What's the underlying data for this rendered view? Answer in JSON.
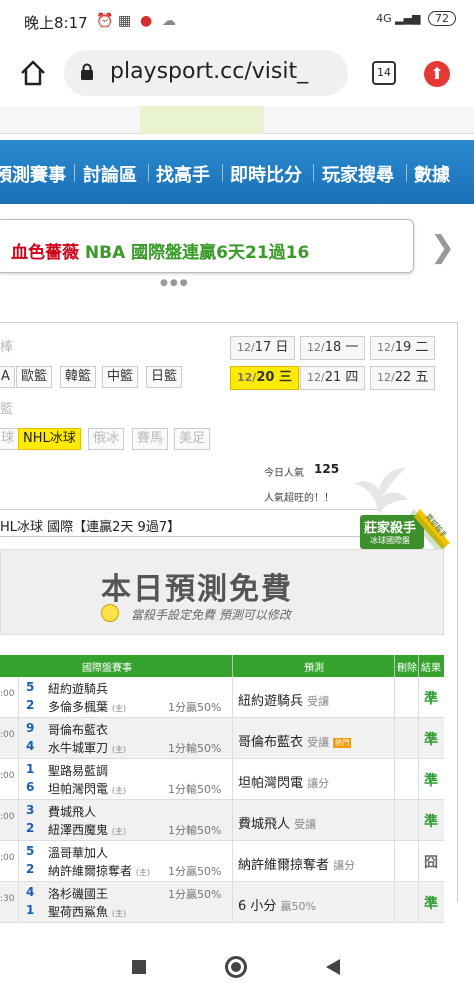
{
  "status_bar": {
    "time": "晚上8:17",
    "network": "4G",
    "battery": "72"
  },
  "browser": {
    "url": "playsport.cc/visit_",
    "tab_count": "14"
  },
  "nav": {
    "items": [
      "預測賽事",
      "討論區",
      "找高手",
      "即時比分",
      "玩家搜尋",
      "數據"
    ]
  },
  "banner": {
    "name": "血色薔薇",
    "text": "NBA 國際盤連贏6天21過16",
    "name_color": "#d0021b",
    "text_color": "#3a9a2a"
  },
  "leagues": {
    "row1": [
      "A",
      "歐籃",
      "韓籃",
      "中籃",
      "日籃"
    ],
    "row3": [
      "球",
      "NHL冰球",
      "俄冰",
      "賽馬",
      "美足"
    ],
    "selected": "NHL冰球"
  },
  "dates": [
    {
      "md": "12/",
      "d": "17",
      "w": "日"
    },
    {
      "md": "12/",
      "d": "18",
      "w": "一"
    },
    {
      "md": "12/",
      "d": "19",
      "w": "二"
    },
    {
      "md": "12/",
      "d": "20",
      "w": "三",
      "selected": true
    },
    {
      "md": "12/",
      "d": "21",
      "w": "四"
    },
    {
      "md": "12/",
      "d": "22",
      "w": "五"
    }
  ],
  "popularity": {
    "label": "今日人氣",
    "value": "125",
    "note": "人氣超旺的！！"
  },
  "league_bar": {
    "text": "HL冰球 國際【連贏2天 9過7】"
  },
  "stamp": {
    "title": "莊家殺手",
    "sub": "冰球國際盤",
    "ribbon": "買前殺手"
  },
  "free_box": {
    "title": "本日預測免費",
    "subtitle": "當殺手設定免費  預測可以修改"
  },
  "table": {
    "headers": {
      "game": "國際盤賽事",
      "pick": "預測",
      "delete": "刪除",
      "result": "結果"
    },
    "home_tag": "(主)",
    "rows": [
      {
        "time": ":00",
        "n1": "5",
        "t1": "紐約遊騎兵",
        "n2": "2",
        "t2": "多倫多楓葉",
        "handicap": "1分贏50%",
        "pick": "紐約遊騎兵",
        "pick_type": "受讓",
        "hot": "",
        "result": "準"
      },
      {
        "time": ":00",
        "n1": "9",
        "t1": "哥倫布藍衣",
        "n2": "4",
        "t2": "水牛城軍刀",
        "handicap": "1分輸50%",
        "pick": "哥倫布藍衣",
        "pick_type": "受讓",
        "hot": "熱門",
        "result": "準"
      },
      {
        "time": ":00",
        "n1": "1",
        "t1": "聖路易藍調",
        "n2": "6",
        "t2": "坦帕灣閃電",
        "handicap": "1分輸50%",
        "pick": "坦帕灣閃電",
        "pick_type": "讓分",
        "hot": "",
        "result": "準"
      },
      {
        "time": ":00",
        "n1": "3",
        "t1": "費城飛人",
        "n2": "2",
        "t2": "紐澤西魔鬼",
        "handicap": "1分輸50%",
        "pick": "費城飛人",
        "pick_type": "受讓",
        "hot": "",
        "result": "準"
      },
      {
        "time": ":00",
        "n1": "5",
        "t1": "溫哥華加人",
        "n2": "2",
        "t2": "納許維爾掠奪者",
        "handicap": "1分贏50%",
        "pick": "納許維爾掠奪者",
        "pick_type": "讓分",
        "hot": "",
        "result": "囧"
      },
      {
        "time": ":30",
        "n1": "4",
        "t1": "洛杉磯國王",
        "n2": "1",
        "t2": "聖荷西鯊魚",
        "handicap": "1分贏50%",
        "pick": "6 小分",
        "pick_type": "贏50%",
        "hot": "",
        "result": "準"
      }
    ]
  }
}
